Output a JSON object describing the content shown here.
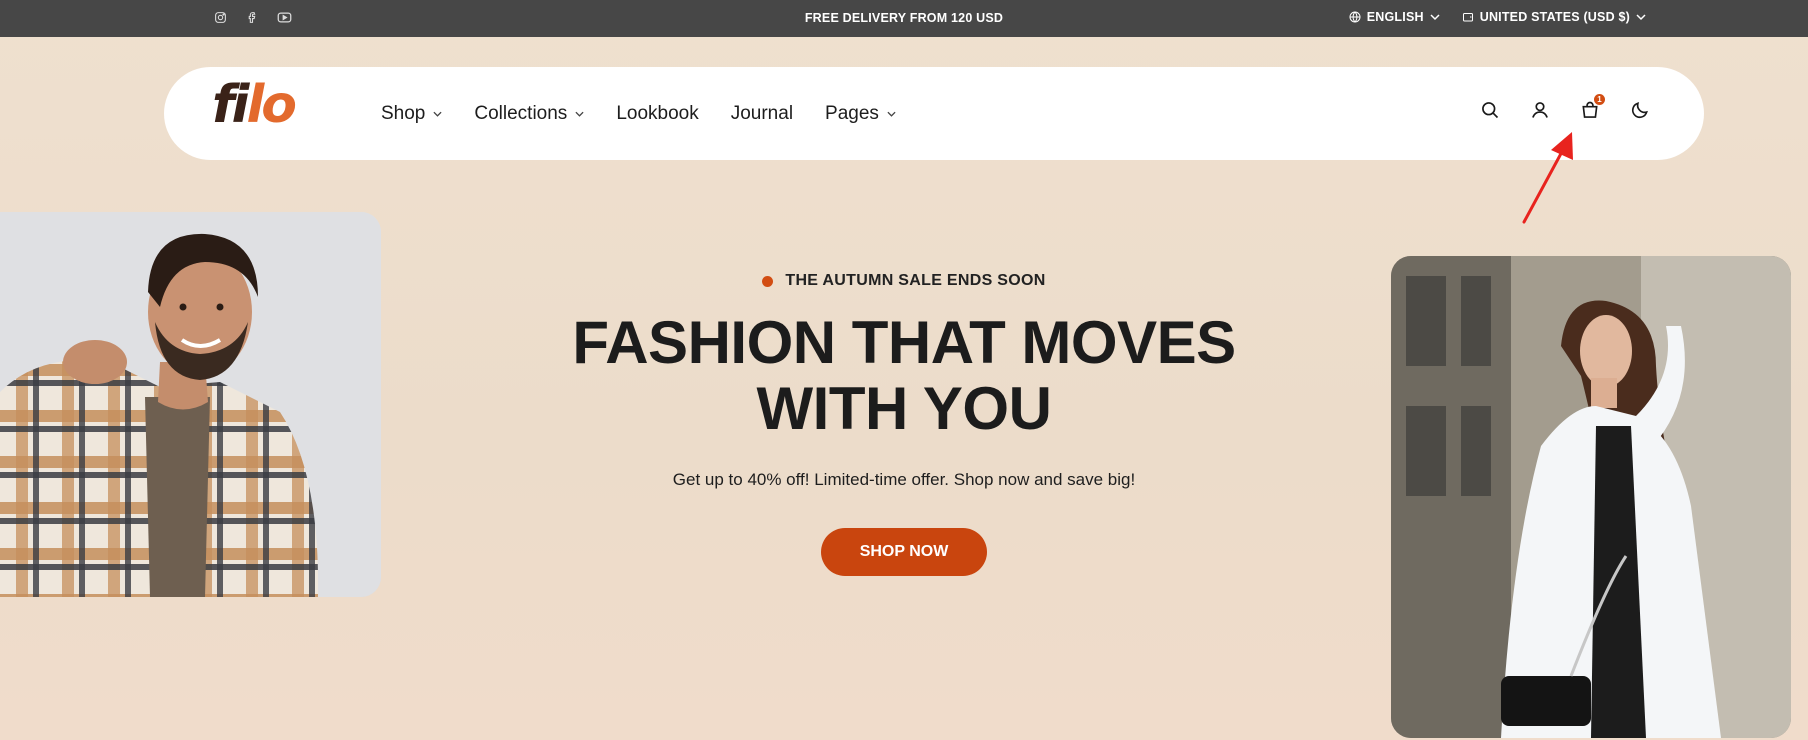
{
  "topbar": {
    "announcement": "FREE DELIVERY FROM 120 USD",
    "social_icons": [
      "instagram-icon",
      "facebook-icon",
      "youtube-icon"
    ],
    "language": "ENGLISH",
    "currency": "UNITED STATES (USD $)"
  },
  "nav": {
    "logo_part1": "fi",
    "logo_part2": "lo",
    "items": [
      {
        "label": "Shop",
        "has_dropdown": true
      },
      {
        "label": "Collections",
        "has_dropdown": true
      },
      {
        "label": "Lookbook",
        "has_dropdown": false
      },
      {
        "label": "Journal",
        "has_dropdown": false
      },
      {
        "label": "Pages",
        "has_dropdown": true
      }
    ],
    "icons": [
      "search-icon",
      "account-icon",
      "cart-icon",
      "dark-mode-icon"
    ],
    "cart_count": "1"
  },
  "hero": {
    "eyebrow": "THE AUTUMN SALE ENDS SOON",
    "headline_line1": "FASHION THAT MOVES",
    "headline_line2": "WITH YOU",
    "subtext": "Get up to 40% off! Limited-time offer. Shop now and save big!",
    "cta": "SHOP NOW"
  },
  "colors": {
    "topbar_bg": "#474747",
    "accent": "#c9450e",
    "page_bg": "#ecdcca",
    "annotation_arrow": "#e8231e"
  }
}
